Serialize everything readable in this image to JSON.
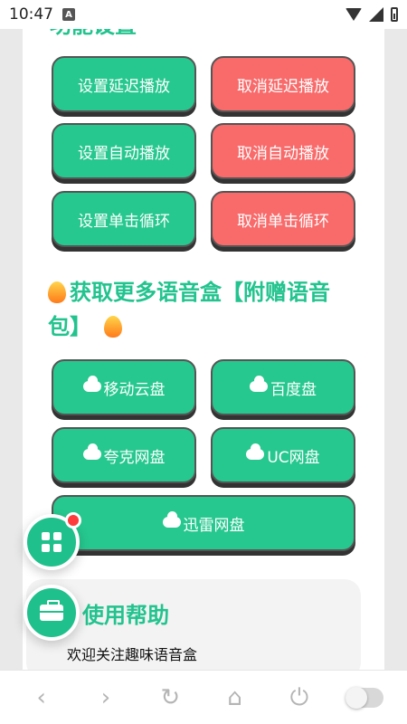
{
  "status_bar": {
    "time": "10:47",
    "notification_letter": "A"
  },
  "section_settings": {
    "title": "功能设置",
    "buttons": [
      {
        "label": "设置延迟播放",
        "color": "#26c88f"
      },
      {
        "label": "取消延迟播放",
        "color": "#f96a6a"
      },
      {
        "label": "设置自动播放",
        "color": "#26c88f"
      },
      {
        "label": "取消自动播放",
        "color": "#f96a6a"
      },
      {
        "label": "设置单击循环",
        "color": "#26c88f"
      },
      {
        "label": "取消单击循环",
        "color": "#f96a6a"
      }
    ]
  },
  "section_download": {
    "title": "获取更多语音盒【附赠语音包】",
    "buttons": [
      {
        "label": "移动云盘",
        "icon": "cloud-icon"
      },
      {
        "label": "百度盘",
        "icon": "cloud-icon"
      },
      {
        "label": "夸克网盘",
        "icon": "cloud-icon"
      },
      {
        "label": "UC网盘",
        "icon": "cloud-icon"
      },
      {
        "label": "迅雷网盘",
        "icon": "cloud-icon"
      }
    ]
  },
  "section_help": {
    "title": "使用帮助",
    "text": "欢迎关注趣味语音盒"
  },
  "fab": {
    "apps_badge": true
  },
  "nav": {
    "back": "‹",
    "forward": "›",
    "refresh": "↻",
    "home": "⌂",
    "power": "⏻"
  },
  "colors": {
    "accent": "#22c38e",
    "danger": "#f96a6a",
    "fab": "#1fc08c"
  }
}
